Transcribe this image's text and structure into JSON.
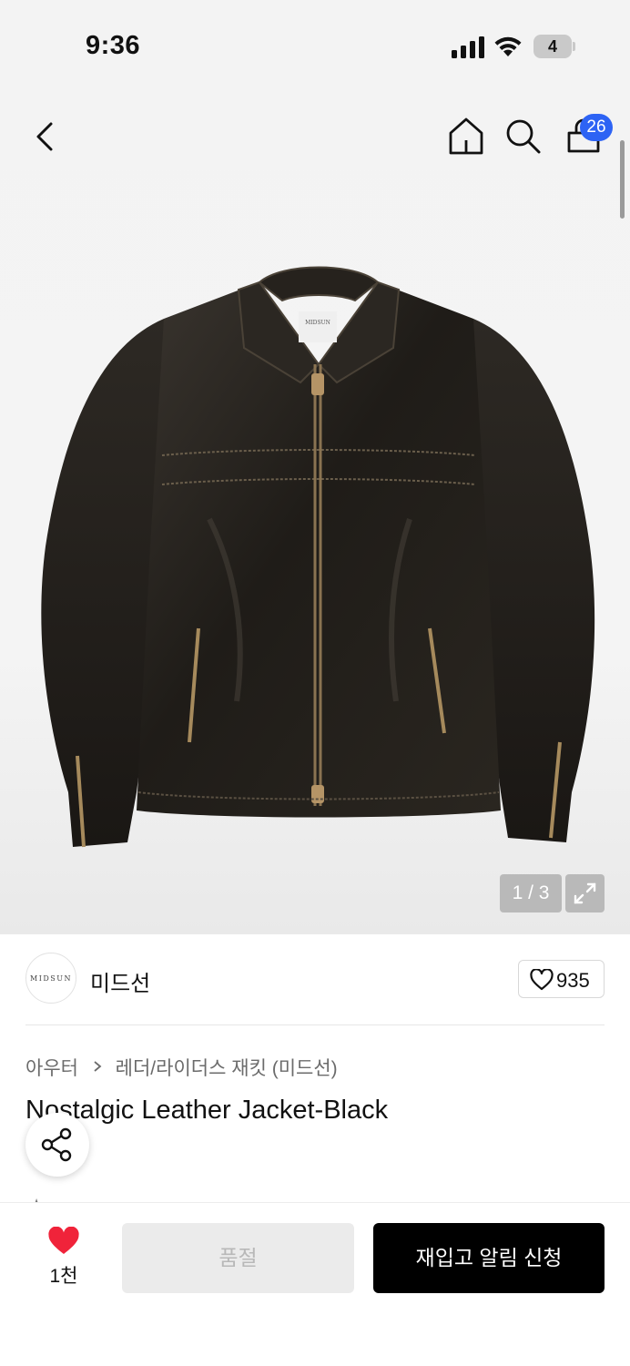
{
  "status_bar": {
    "time": "9:36",
    "battery_level": "4",
    "icons": [
      "signal-icon",
      "wifi-icon",
      "battery-icon"
    ]
  },
  "nav": {
    "icons": [
      "back-icon",
      "home-icon",
      "search-icon",
      "cart-icon"
    ],
    "cart_badge": "26"
  },
  "gallery": {
    "counter": "1 / 3",
    "expand_icon": "expand-icon"
  },
  "brand": {
    "logo_text": "MIDSUN",
    "name": "미드선",
    "likes": "935"
  },
  "breadcrumb": {
    "category": "아우터",
    "subcategory": "레더/라이더스 재킷 (미드선)"
  },
  "product": {
    "title": "Nostalgic Leather Jacket-Black",
    "label_text": "MIDSUN"
  },
  "bottom_bar": {
    "wish_count": "1천",
    "soldout_label": "품절",
    "restock_label": "재입고 알림 신청"
  },
  "colors": {
    "badge": "#2d63f4",
    "heart": "#f0233a",
    "primary_button": "#000000",
    "disabled_button": "#ebebeb"
  }
}
